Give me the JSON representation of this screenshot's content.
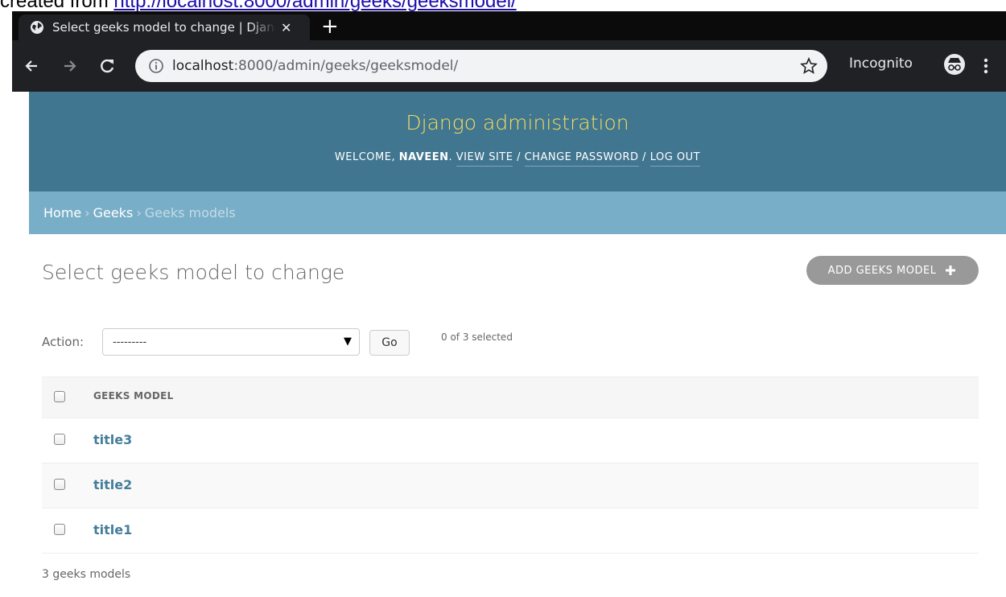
{
  "caption": {
    "prefix": "created from ",
    "link": "http://localhost:8000/admin/geeks/geeksmodel/"
  },
  "browser": {
    "tab_title": "Select geeks model to change | Django site admin",
    "url_host": "localhost",
    "url_rest": ":8000/admin/geeks/geeksmodel/",
    "mode_label": "Incognito",
    "icons": {
      "tab": "globe-icon",
      "close": "close-icon",
      "new_tab": "plus-icon",
      "back": "arrow-left-icon",
      "forward": "arrow-right-icon",
      "reload": "reload-icon",
      "info": "info-icon",
      "bookmark": "star-icon",
      "incognito": "incognito-icon",
      "menu": "kebab-menu-icon"
    }
  },
  "header": {
    "branding": "Django administration",
    "welcome": "WELCOME, ",
    "username": "NAVEEN",
    "period": ".",
    "view_site": "VIEW SITE",
    "change_password": "CHANGE PASSWORD",
    "log_out": "LOG OUT",
    "sep": " / "
  },
  "breadcrumbs": {
    "home": "Home",
    "sep": "›",
    "app": "Geeks",
    "current": "Geeks models"
  },
  "content": {
    "title": "Select geeks model to change",
    "add_button": "ADD GEEKS MODEL"
  },
  "actions": {
    "label": "Action:",
    "selected_value": "---------",
    "go_label": "Go",
    "counter": "0 of 3 selected"
  },
  "table": {
    "column": "GEEKS MODEL",
    "rows": [
      {
        "title": "title3"
      },
      {
        "title": "title2"
      },
      {
        "title": "title1"
      }
    ]
  },
  "paginator": "3 geeks models",
  "colors": {
    "header_bg": "#417690",
    "branding": "#f5dd5d",
    "breadcrumbs_bg": "#79aec8",
    "link": "#447e9b",
    "add_button_bg": "#999999"
  }
}
